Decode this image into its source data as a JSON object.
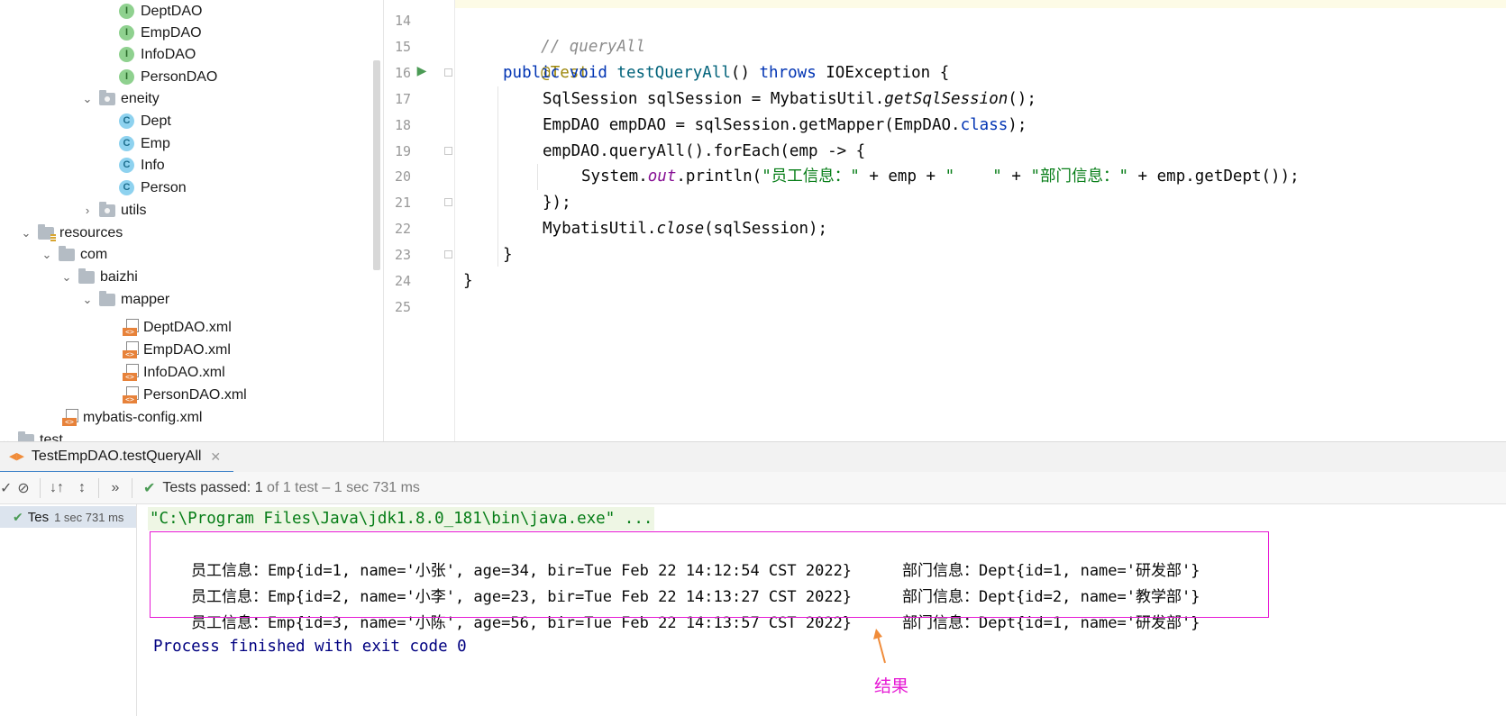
{
  "project_tree": {
    "items": [
      {
        "label": "DeptDAO",
        "icon": "interface-icon",
        "badge": "I"
      },
      {
        "label": "EmpDAO",
        "icon": "interface-icon",
        "badge": "I"
      },
      {
        "label": "InfoDAO",
        "icon": "interface-icon",
        "badge": "I"
      },
      {
        "label": "PersonDAO",
        "icon": "interface-icon",
        "badge": "I"
      },
      {
        "label": "eneity",
        "icon": "package-folder-icon"
      },
      {
        "label": "Dept",
        "icon": "class-icon",
        "badge": "C"
      },
      {
        "label": "Emp",
        "icon": "class-icon",
        "badge": "C"
      },
      {
        "label": "Info",
        "icon": "class-icon",
        "badge": "C"
      },
      {
        "label": "Person",
        "icon": "class-icon",
        "badge": "C"
      },
      {
        "label": "utils",
        "icon": "package-folder-icon"
      },
      {
        "label": "resources",
        "icon": "resources-folder-icon"
      },
      {
        "label": "com",
        "icon": "folder-icon"
      },
      {
        "label": "baizhi",
        "icon": "folder-icon"
      },
      {
        "label": "mapper",
        "icon": "folder-icon"
      },
      {
        "label": "DeptDAO.xml",
        "icon": "xml-file-icon"
      },
      {
        "label": "EmpDAO.xml",
        "icon": "xml-file-icon"
      },
      {
        "label": "InfoDAO.xml",
        "icon": "xml-file-icon"
      },
      {
        "label": "PersonDAO.xml",
        "icon": "xml-file-icon"
      },
      {
        "label": "mybatis-config.xml",
        "icon": "xml-file-icon"
      },
      {
        "label": "test",
        "icon": "folder-icon"
      }
    ]
  },
  "editor": {
    "line_numbers": [
      "14",
      "15",
      "16",
      "17",
      "18",
      "19",
      "20",
      "21",
      "22",
      "23",
      "24",
      "25"
    ],
    "lines": {
      "l14": {
        "comment": "// queryAll"
      },
      "l15": {
        "annotation": "@Test"
      },
      "l16": {
        "kw1": "public",
        "kw2": "void",
        "method": "testQueryAll",
        "p1": "() ",
        "kw3": "throws",
        "p2": " IOException {"
      },
      "l17": {
        "a": "SqlSession sqlSession = MybatisUtil.",
        "b": "getSqlSession",
        "c": "();"
      },
      "l18": {
        "a": "EmpDAO empDAO = sqlSession.getMapper(EmpDAO.",
        "b": "class",
        "c": ");"
      },
      "l19": {
        "a": "empDAO.queryAll().forEach(emp -> {"
      },
      "l20": {
        "a": "System.",
        "b": "out",
        "c": ".println(",
        "s1": "\"员工信息：\"",
        "d": " + emp + ",
        "s2": "\"    \"",
        "e": " + ",
        "s3": "\"部门信息：\"",
        "f": " + emp.getDept());"
      },
      "l21": {
        "a": "});"
      },
      "l22": {
        "a": "MybatisUtil.",
        "b": "close",
        "c": "(sqlSession);"
      },
      "l23": {
        "a": "}"
      },
      "l24": {
        "a": "}"
      }
    }
  },
  "run_panel": {
    "tab_label": "TestEmpDAO.testQueryAll",
    "tests_passed_label": "Tests passed:",
    "tests_passed_count": "1",
    "tests_passed_detail": "of 1 test – 1 sec 731 ms",
    "tree_item_label": "Tes",
    "tree_item_duration": "1 sec 731 ms",
    "console": {
      "command": "\"C:\\Program Files\\Java\\jdk1.8.0_181\\bin\\java.exe\" ...",
      "rows": [
        {
          "emp": "员工信息：Emp{id=1, name='小张', age=34, bir=Tue Feb 22 14:12:54 CST 2022}",
          "dept": "部门信息：Dept{id=1, name='研发部'}"
        },
        {
          "emp": "员工信息：Emp{id=2, name='小李', age=23, bir=Tue Feb 22 14:13:27 CST 2022}",
          "dept": "部门信息：Dept{id=2, name='教学部'}"
        },
        {
          "emp": "员工信息：Emp{id=3, name='小陈', age=56, bir=Tue Feb 22 14:13:57 CST 2022}",
          "dept": "部门信息：Dept{id=1, name='研发部'}"
        }
      ],
      "exit": "Process finished with exit code 0"
    }
  },
  "annotation": {
    "label": "结果",
    "color": "#e619d4",
    "arrow_color": "#f08c3a"
  }
}
